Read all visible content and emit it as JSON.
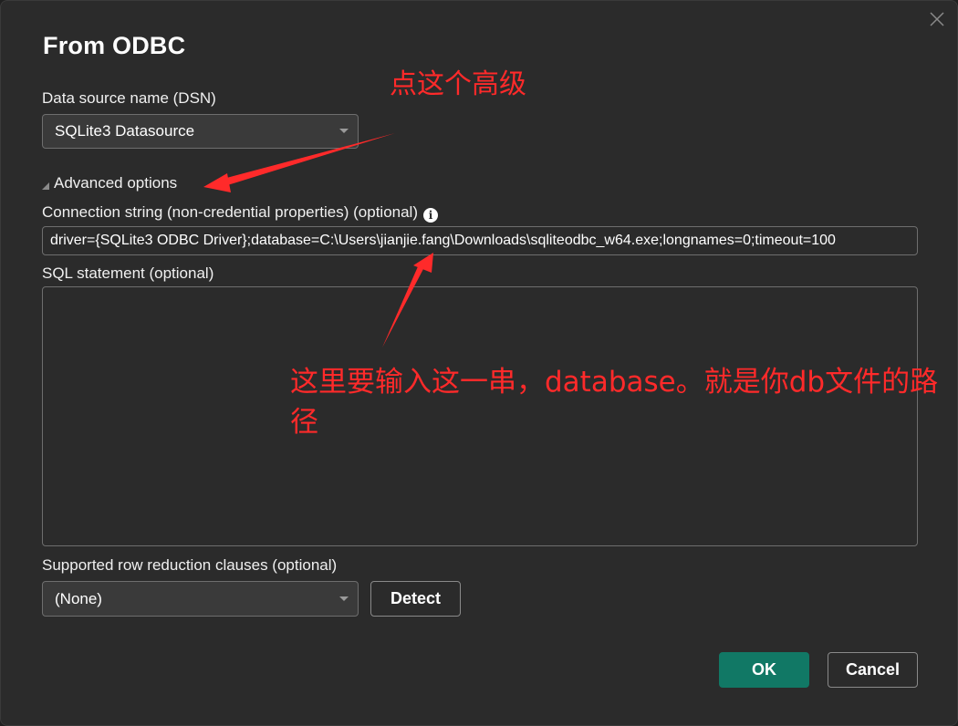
{
  "dialog": {
    "title": "From ODBC",
    "close_icon": "close-icon"
  },
  "dsn": {
    "label": "Data source name (DSN)",
    "selected": "SQLite3 Datasource"
  },
  "advanced": {
    "label": "Advanced options",
    "expanded": true
  },
  "connection_string": {
    "label": "Connection string (non-credential properties) (optional)",
    "info_icon": "i",
    "value": "driver={SQLite3 ODBC Driver};database=C:\\Users\\jianjie.fang\\Downloads\\sqliteodbc_w64.exe;longnames=0;timeout=100"
  },
  "sql_statement": {
    "label": "SQL statement (optional)",
    "value": ""
  },
  "row_reduction": {
    "label": "Supported row reduction clauses (optional)",
    "selected": "(None)",
    "detect_label": "Detect"
  },
  "footer": {
    "ok_label": "OK",
    "cancel_label": "Cancel"
  },
  "annotations": {
    "note_1": "点这个高级",
    "note_2_line_1": "这里要输入这一串，database。就是你db文件的路",
    "note_2_line_2": "径",
    "color": "#ff2a2a"
  },
  "colors": {
    "dialog_bg": "#2b2b2b",
    "ok_button": "#117865",
    "border": "#6e6e6e"
  }
}
